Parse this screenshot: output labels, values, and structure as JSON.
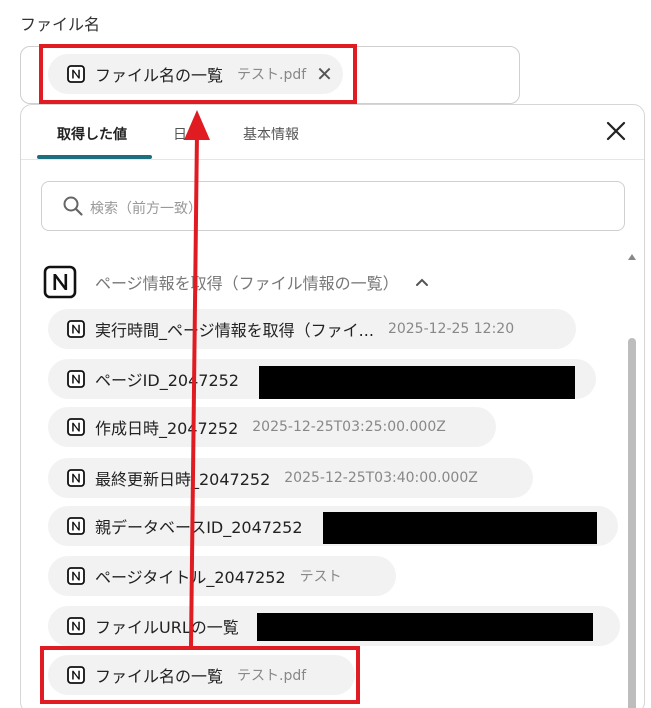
{
  "field": {
    "label": "ファイル名"
  },
  "selected_chip": {
    "label": "ファイル名の一覧",
    "value": "テスト.pdf"
  },
  "tabs": [
    {
      "label": "取得した値"
    },
    {
      "label": "日"
    },
    {
      "label": "基本情報"
    }
  ],
  "search": {
    "placeholder": "検索（前方一致）"
  },
  "section": {
    "title": "ページ情報を取得（ファイル情報の一覧）"
  },
  "items": [
    {
      "label": "実行時間_ページ情報を取得（ファイ...",
      "value": "2025-12-25 12:20"
    },
    {
      "label": "ページID_2047252",
      "value": ""
    },
    {
      "label": "作成日時_2047252",
      "value": "2025-12-25T03:25:00.000Z"
    },
    {
      "label": "最終更新日時_2047252",
      "value": "2025-12-25T03:40:00.000Z"
    },
    {
      "label": "親データベースID_2047252",
      "value": ""
    },
    {
      "label": "ページタイトル_2047252",
      "value": "テスト"
    },
    {
      "label": "ファイルURLの一覧",
      "value": ""
    },
    {
      "label": "ファイル名の一覧",
      "value": "テスト.pdf"
    }
  ],
  "colors": {
    "highlight": "#e01b22",
    "tab_accent": "#1d6f80"
  }
}
